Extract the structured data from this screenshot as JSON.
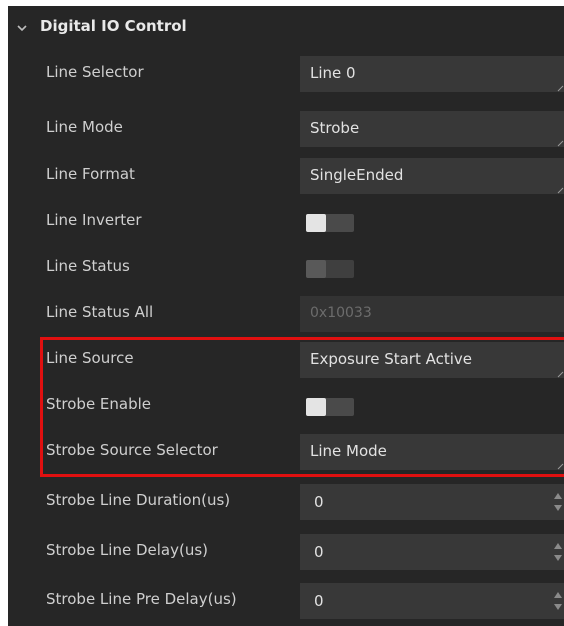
{
  "section": {
    "title": "Digital IO Control",
    "icon": "chevron-down-icon"
  },
  "rows": {
    "line_selector": {
      "label": "Line Selector",
      "value": "Line 0"
    },
    "line_mode": {
      "label": "Line Mode",
      "value": "Strobe"
    },
    "line_format": {
      "label": "Line Format",
      "value": "SingleEnded"
    },
    "line_inverter": {
      "label": "Line Inverter",
      "toggle_on": false
    },
    "line_status": {
      "label": "Line Status",
      "toggle_on": false
    },
    "line_status_all": {
      "label": "Line Status All",
      "value": "0x10033"
    },
    "line_source": {
      "label": "Line Source",
      "value": "Exposure Start Active"
    },
    "strobe_enable": {
      "label": "Strobe Enable",
      "toggle_on": false
    },
    "strobe_source_selector": {
      "label": "Strobe Source Selector",
      "value": "Line Mode"
    },
    "strobe_line_duration": {
      "label": "Strobe Line Duration(us)",
      "value": "0"
    },
    "strobe_line_delay": {
      "label": "Strobe Line Delay(us)",
      "value": "0"
    },
    "strobe_line_pre_delay": {
      "label": "Strobe Line Pre Delay(us)",
      "value": "0"
    }
  },
  "colors": {
    "panel_bg": "#262626",
    "field_bg": "#383838",
    "highlight_border": "#e01010"
  }
}
